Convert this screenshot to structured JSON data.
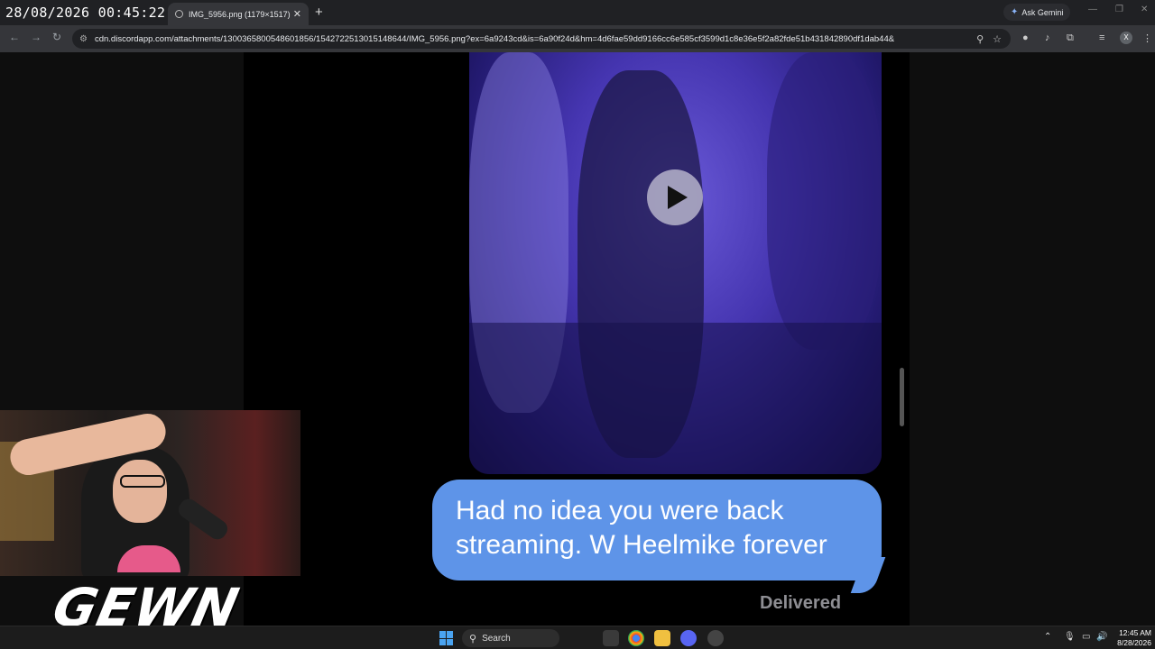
{
  "overlay": {
    "datetime": "28/08/2026 00:45:22"
  },
  "browser": {
    "tab_title": "IMG_5956.png (1179×1517)",
    "tab_close_icon": "close-icon",
    "new_tab_icon": "plus-icon",
    "ask_gemini_label": "Ask Gemini",
    "url": "cdn.discordapp.com/attachments/1300365800548601856/1542722513015148644/IMG_5956.png?ex=6a9243cd&is=6a90f24d&hm=4d6fae59dd9166cc6e585cf3599d1c8e36e5f2a82fde51b431842890df1dab44&",
    "profile_initial": "X"
  },
  "message": {
    "text_line1": "Had no idea you were back",
    "text_line2": "streaming. W Heelmike forever",
    "status": "Delivered",
    "bubble_color": "#5e94e8"
  },
  "stream": {
    "logo_text": "GEWN"
  },
  "taskbar": {
    "search_label": "Search",
    "clock_time": "12:45 AM",
    "clock_date": "8/28/2026"
  }
}
